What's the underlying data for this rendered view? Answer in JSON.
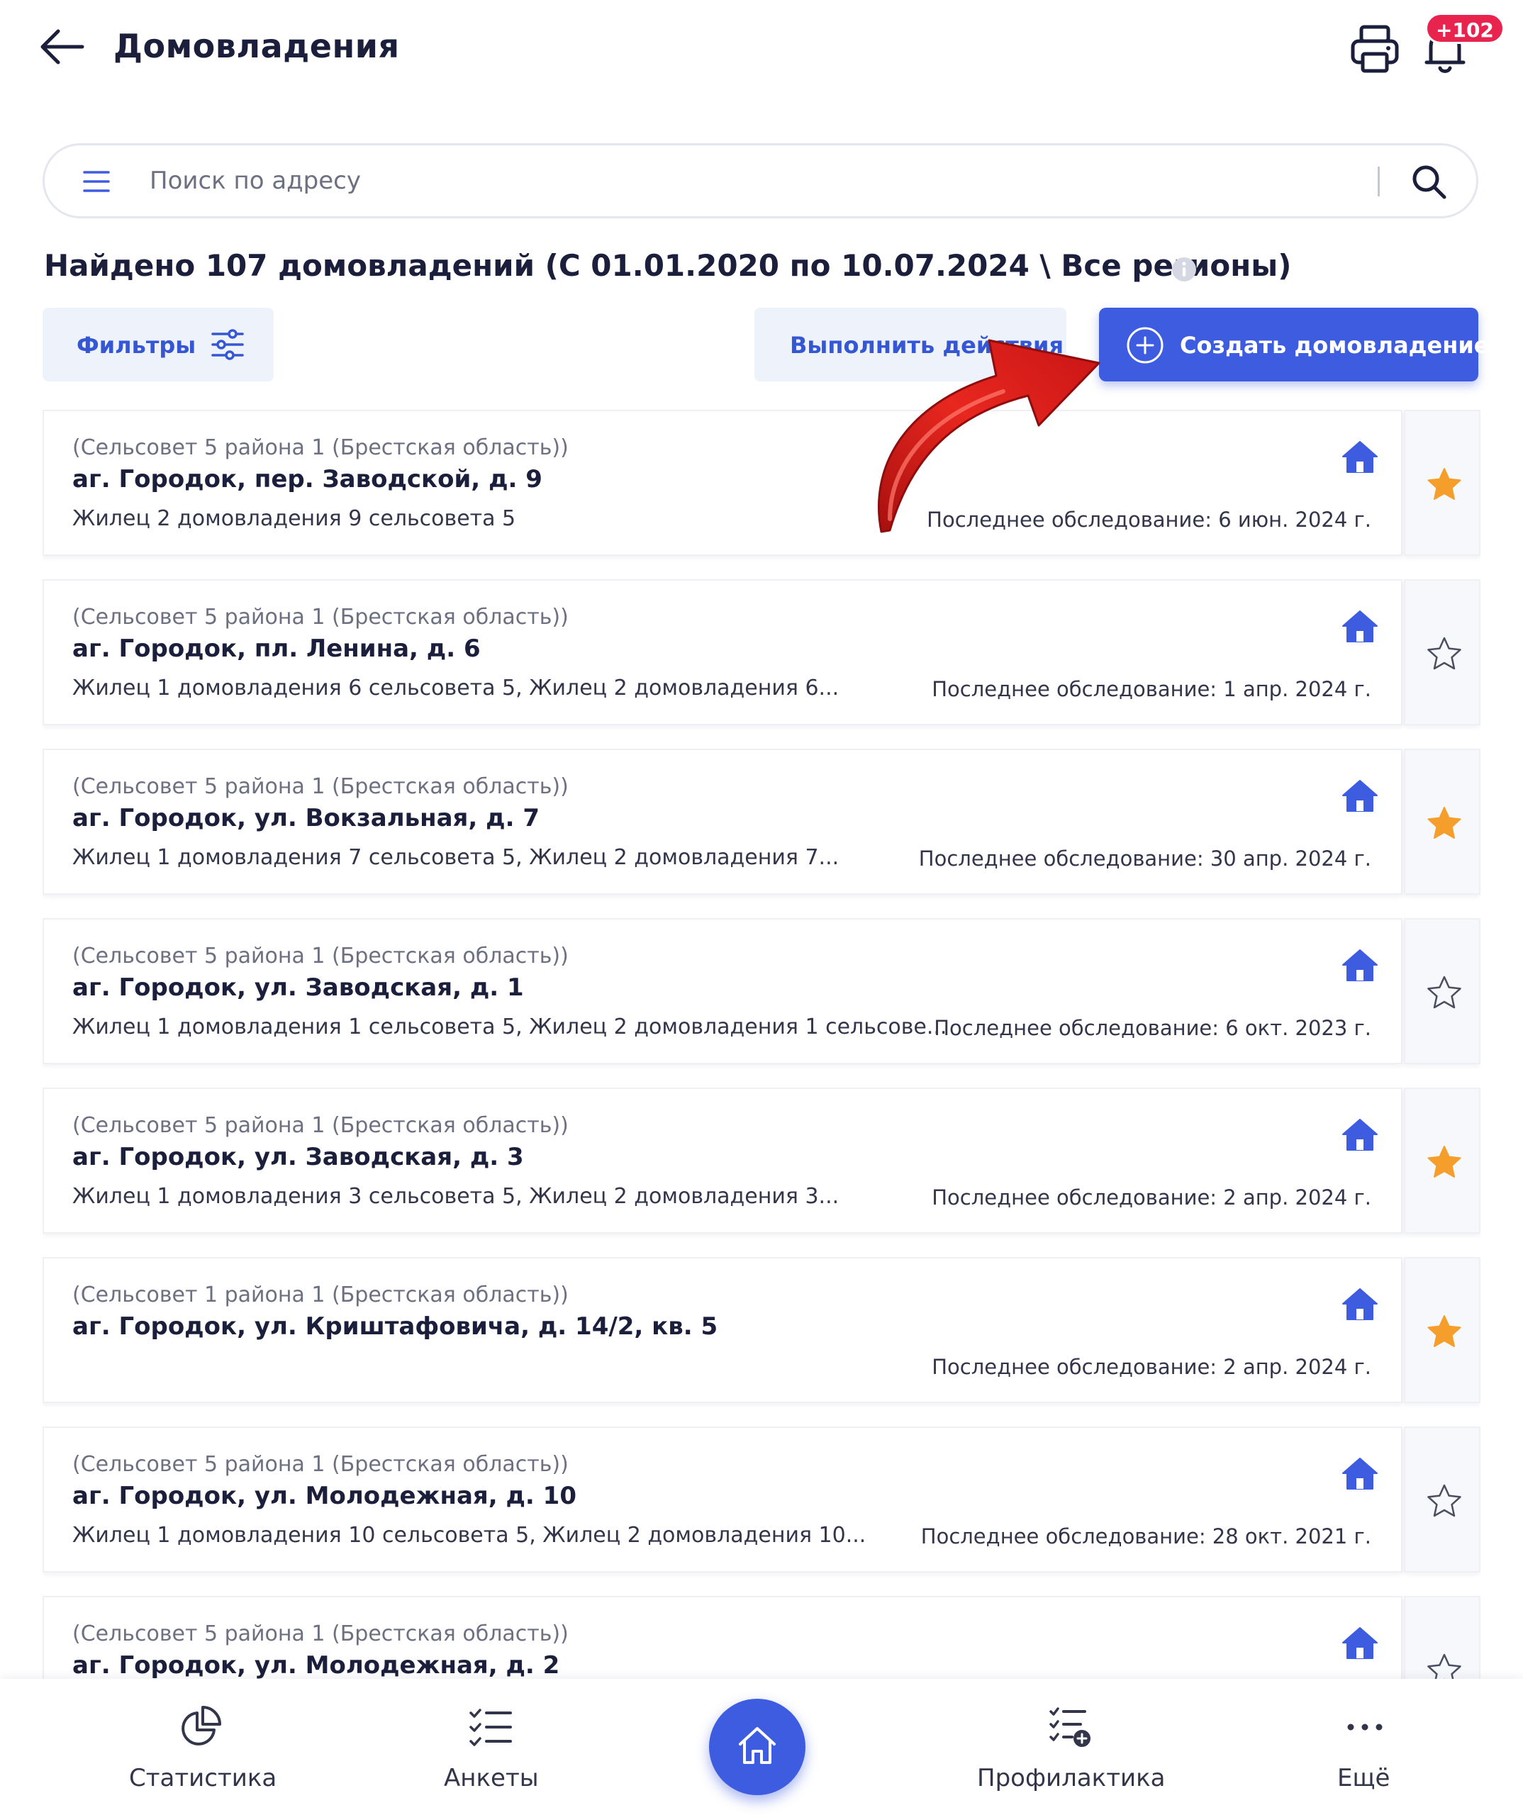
{
  "header": {
    "title": "Домовладения",
    "back_icon": "arrow-left-icon",
    "print_icon": "printer-icon",
    "bell_icon": "bell-icon",
    "notification_count": "+102"
  },
  "search": {
    "placeholder": "Поиск по адресу",
    "value": ""
  },
  "summary": {
    "found_text": "Найдено 107 домовладений (С 01.01.2020 по 10.07.2024 \\ Все регионы)"
  },
  "toolbar": {
    "filters_label": "Фильтры",
    "action_label": "Выполнить действия",
    "create_label": "Создать домовладение"
  },
  "colors": {
    "accent": "#3d5ce0",
    "star_filled": "#f59e2b",
    "badge": "#e8244e",
    "arrow": "#d8201f"
  },
  "households": [
    {
      "region": "(Сельсовет 5 района 1 (Брестская область))",
      "address": "аг. Городок, пер. Заводской, д. 9",
      "residents": "Жилец 2 домовладения 9 сельсовета 5",
      "last_survey": "Последнее обследование: 6 июн. 2024 г.",
      "favorite": true
    },
    {
      "region": "(Сельсовет 5 района 1 (Брестская область))",
      "address": "аг. Городок, пл. Ленина, д. 6",
      "residents": "Жилец 1 домовладения 6 сельсовета 5, Жилец 2 домовладения 6...",
      "last_survey": "Последнее обследование: 1 апр. 2024 г.",
      "favorite": false
    },
    {
      "region": "(Сельсовет 5 района 1 (Брестская область))",
      "address": "аг. Городок, ул. Вокзальная, д. 7",
      "residents": "Жилец 1 домовладения 7 сельсовета 5, Жилец 2 домовладения 7...",
      "last_survey": "Последнее обследование: 30 апр. 2024 г.",
      "favorite": true
    },
    {
      "region": "(Сельсовет 5 района 1 (Брестская область))",
      "address": "аг. Городок, ул. Заводская, д. 1",
      "residents": "Жилец 1 домовладения 1 сельсовета 5, Жилец 2 домовладения 1 сельсове...",
      "last_survey": "Последнее обследование: 6 окт. 2023 г.",
      "favorite": false
    },
    {
      "region": "(Сельсовет 5 района 1 (Брестская область))",
      "address": "аг. Городок, ул. Заводская, д. 3",
      "residents": "Жилец 1 домовладения 3 сельсовета 5, Жилец 2 домовладения 3...",
      "last_survey": "Последнее обследование: 2 апр. 2024 г.",
      "favorite": true
    },
    {
      "region": "(Сельсовет 1 района 1 (Брестская область))",
      "address": "аг. Городок, ул. Криштафовича, д. 14/2, кв. 5",
      "residents": "",
      "last_survey": "Последнее обследование: 2 апр. 2024 г.",
      "favorite": true
    },
    {
      "region": "(Сельсовет 5 района 1 (Брестская область))",
      "address": "аг. Городок, ул. Молодежная, д. 10",
      "residents": "Жилец 1 домовладения 10 сельсовета 5, Жилец 2 домовладения 10...",
      "last_survey": "Последнее обследование: 28 окт. 2021 г.",
      "favorite": false
    },
    {
      "region": "(Сельсовет 5 района 1 (Брестская область))",
      "address": "аг. Городок, ул. Молодежная, д. 2",
      "residents": "",
      "last_survey": "",
      "favorite": false
    }
  ],
  "bottom_nav": {
    "stats_label": "Статистика",
    "forms_label": "Анкеты",
    "prevention_label": "Профилактика",
    "more_label": "Ещё"
  }
}
